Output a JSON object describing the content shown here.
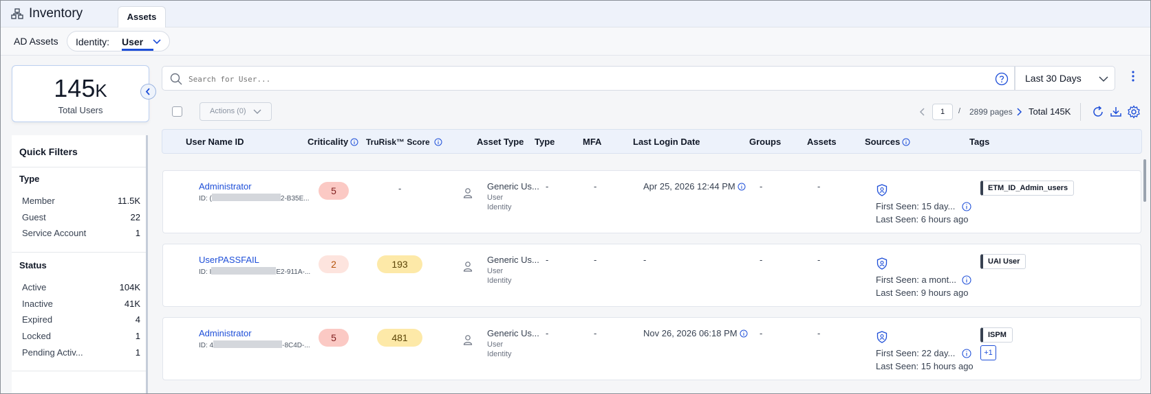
{
  "app": {
    "title": "Inventory",
    "icon": "hierarchy-icon",
    "tabs": [
      {
        "label": "Assets",
        "active": true
      }
    ]
  },
  "subnav": {
    "ad_assets": "AD Assets",
    "identity_label": "Identity:",
    "identity_value": "User"
  },
  "summary": {
    "value": "145",
    "unit": "K",
    "label": "Total Users"
  },
  "quick_filters": {
    "title": "Quick Filters",
    "groups": [
      {
        "title": "Type",
        "items": [
          {
            "label": "Member",
            "count": "11.5K"
          },
          {
            "label": "Guest",
            "count": "22"
          },
          {
            "label": "Service Account",
            "count": "1"
          }
        ]
      },
      {
        "title": "Status",
        "items": [
          {
            "label": "Active",
            "count": "104K"
          },
          {
            "label": "Inactive",
            "count": "41K"
          },
          {
            "label": "Expired",
            "count": "4"
          },
          {
            "label": "Locked",
            "count": "1"
          },
          {
            "label": "Pending Activ...",
            "count": "1"
          }
        ]
      }
    ]
  },
  "search": {
    "placeholder": "Search for User...",
    "date_range": "Last 30 Days"
  },
  "toolbar": {
    "actions_label": "Actions (0)"
  },
  "pagination": {
    "page": "1",
    "slash": "/",
    "pages": "2899 pages",
    "total": "Total 145K"
  },
  "table": {
    "columns": [
      "User Name ID",
      "Criticality",
      "TruRisk™ Score",
      "Asset Type",
      "Type",
      "MFA",
      "Last Login Date",
      "Groups",
      "Assets",
      "Sources",
      "Tags"
    ],
    "rows": [
      {
        "name": "Administrator",
        "id_prefix": "ID: (",
        "id_suffix": "2-B35E...",
        "criticality": "5",
        "crit_level": "high",
        "trurisk": "-",
        "asset_type": "Generic Us...",
        "asset_sub1": "User",
        "asset_sub2": "Identity",
        "type": "-",
        "mfa": "-",
        "last_login": "Apr 25, 2026 12:44 PM",
        "login_info": true,
        "groups": "-",
        "assets": "-",
        "first_seen": "First Seen: 15 day...",
        "last_seen": "Last Seen: 6 hours ago",
        "tags": [
          "ETM_ID_Admin_users"
        ],
        "more_tags": ""
      },
      {
        "name": "UserPASSFAIL",
        "id_prefix": "ID: I",
        "id_suffix": "E2-911A-...",
        "criticality": "2",
        "crit_level": "low",
        "trurisk": "193",
        "asset_type": "Generic Us...",
        "asset_sub1": "User",
        "asset_sub2": "Identity",
        "type": "-",
        "mfa": "-",
        "last_login": "-",
        "login_info": false,
        "groups": "-",
        "assets": "-",
        "first_seen": "First Seen: a mont...",
        "last_seen": "Last Seen: 9 hours ago",
        "tags": [
          "UAI User"
        ],
        "more_tags": ""
      },
      {
        "name": "Administrator",
        "id_prefix": "ID: 4",
        "id_suffix": "-8C4D-...",
        "criticality": "5",
        "crit_level": "high",
        "trurisk": "481",
        "asset_type": "Generic Us...",
        "asset_sub1": "User",
        "asset_sub2": "Identity",
        "type": "-",
        "mfa": "-",
        "last_login": "Nov 26, 2026 06:18 PM",
        "login_info": true,
        "groups": "-",
        "assets": "-",
        "first_seen": "First Seen: 22 day...",
        "last_seen": "Last Seen: 15 hours ago",
        "tags": [
          "ISPM"
        ],
        "more_tags": "+1"
      }
    ]
  },
  "colors": {
    "accent": "#1d4ed8",
    "crit_high_bg": "#fbc9c4",
    "crit_low_bg": "#fde4de",
    "trurisk_bg": "#fde9a8"
  }
}
